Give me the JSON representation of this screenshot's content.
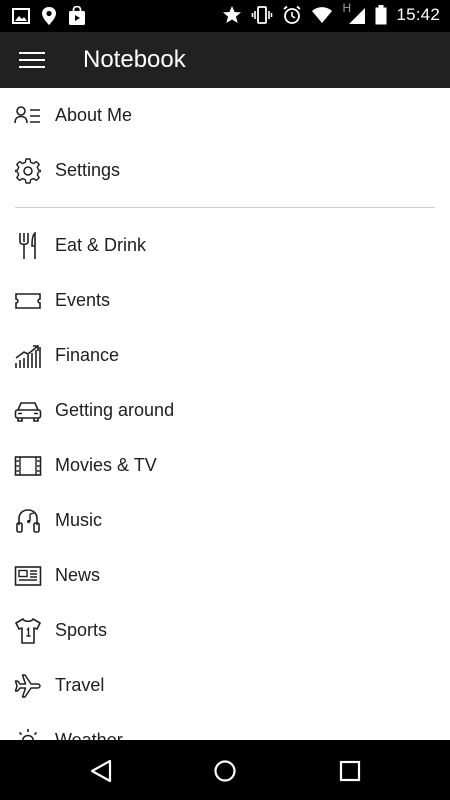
{
  "status_bar": {
    "time": "15:42",
    "network_label": "H",
    "left_icons": [
      "image-icon",
      "location-pin-icon",
      "shopping-bag-icon"
    ],
    "right_icons": [
      "star-icon",
      "vibrate-icon",
      "alarm-icon",
      "wifi-icon",
      "signal-icon",
      "battery-icon"
    ]
  },
  "toolbar": {
    "title": "Notebook",
    "menu_icon": "hamburger-menu-icon",
    "background": "#212121"
  },
  "menu": {
    "top_items": [
      {
        "label": "About Me",
        "icon": "person-list-icon"
      },
      {
        "label": "Settings",
        "icon": "gear-icon"
      }
    ],
    "categories": [
      {
        "label": "Eat & Drink",
        "icon": "fork-knife-icon"
      },
      {
        "label": "Events",
        "icon": "ticket-icon"
      },
      {
        "label": "Finance",
        "icon": "finance-chart-icon"
      },
      {
        "label": "Getting around",
        "icon": "car-icon"
      },
      {
        "label": "Movies & TV",
        "icon": "film-icon"
      },
      {
        "label": "Music",
        "icon": "headphones-icon"
      },
      {
        "label": "News",
        "icon": "newspaper-icon"
      },
      {
        "label": "Sports",
        "icon": "jersey-icon"
      },
      {
        "label": "Travel",
        "icon": "airplane-icon"
      },
      {
        "label": "Weather",
        "icon": "sun-icon"
      }
    ]
  },
  "nav_bar": {
    "buttons": [
      "back-icon",
      "home-icon",
      "recents-icon"
    ]
  }
}
